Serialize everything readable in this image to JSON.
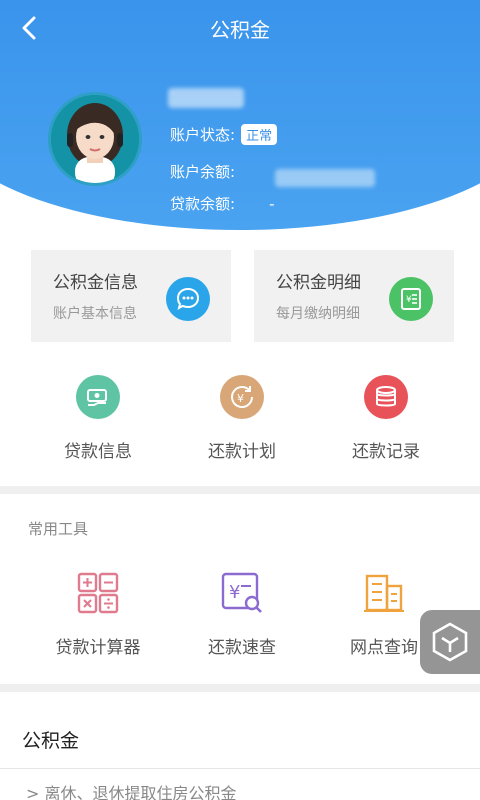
{
  "header": {
    "title": "公积金",
    "status_label": "账户状态:",
    "status_value": "正常",
    "balance_label": "账户余额:",
    "loan_label": "贷款余额:",
    "loan_value": "-"
  },
  "cards": [
    {
      "title": "公积金信息",
      "subtitle": "账户基本信息",
      "icon": "chat-bubble-icon",
      "color": "#2aa5ea"
    },
    {
      "title": "公积金明细",
      "subtitle": "每月缴纳明细",
      "icon": "ledger-icon",
      "color": "#4cc266"
    }
  ],
  "loan_items": [
    {
      "label": "贷款信息",
      "icon": "money-hand-icon",
      "color": "#5fc4a4"
    },
    {
      "label": "还款计划",
      "icon": "yen-clock-icon",
      "color": "#d9a678"
    },
    {
      "label": "还款记录",
      "icon": "coins-stack-icon",
      "color": "#e8535a"
    }
  ],
  "tools": {
    "section_title": "常用工具",
    "items": [
      {
        "label": "贷款计算器",
        "icon": "calculator-icon",
        "color": "#e07a8f"
      },
      {
        "label": "还款速查",
        "icon": "yen-search-icon",
        "color": "#8c6bd1"
      },
      {
        "label": "网点查询",
        "icon": "building-icon",
        "color": "#f0a23c"
      }
    ]
  },
  "gjj_section": {
    "title": "公积金",
    "item": "> 离休、退休提取住房公积金"
  }
}
